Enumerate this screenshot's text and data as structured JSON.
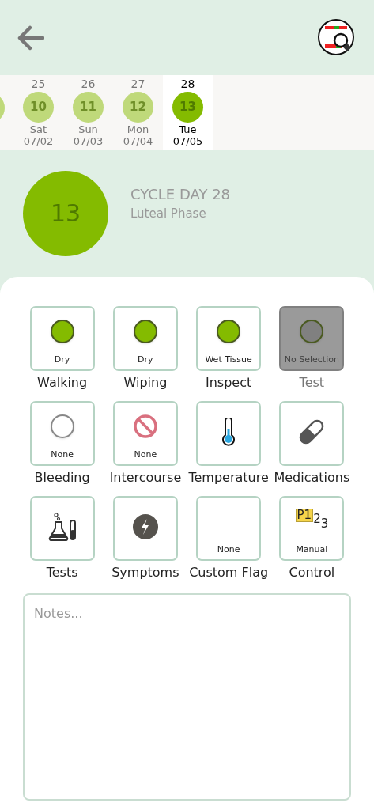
{
  "days": [
    {
      "number": "25",
      "cycle_day": "10",
      "dow": "Sat",
      "date": "07/02",
      "selected": false
    },
    {
      "number": "26",
      "cycle_day": "11",
      "dow": "Sun",
      "date": "07/03",
      "selected": false
    },
    {
      "number": "27",
      "cycle_day": "12",
      "dow": "Mon",
      "date": "07/04",
      "selected": false
    },
    {
      "number": "28",
      "cycle_day": "13",
      "dow": "Tue",
      "date": "07/05",
      "selected": true
    }
  ],
  "summary": {
    "cycle_day": "13",
    "title": "CYCLE DAY 28",
    "phase": "Luteal Phase"
  },
  "tiles": [
    {
      "kind": "dot",
      "color": "#84bb00",
      "value": "Dry",
      "label": "Walking",
      "dimmed": false
    },
    {
      "kind": "dot",
      "color": "#84bb00",
      "value": "Dry",
      "label": "Wiping",
      "dimmed": false
    },
    {
      "kind": "dot",
      "color": "#84bb00",
      "value": "Wet Tissue",
      "label": "Inspect",
      "dimmed": false
    },
    {
      "kind": "dot",
      "color": "#808080",
      "value": "No Selection",
      "label": "Test",
      "dimmed": true
    },
    {
      "kind": "dot",
      "color": "#ffffff",
      "value": "None",
      "label": "Bleeding",
      "dimmed": false
    },
    {
      "kind": "no",
      "value": "None",
      "label": "Intercourse",
      "dimmed": false
    },
    {
      "kind": "thermometer",
      "label": "Temperature",
      "dimmed": false
    },
    {
      "kind": "pill",
      "label": "Medications",
      "dimmed": false
    },
    {
      "kind": "flask",
      "label": "Tests",
      "dimmed": false
    },
    {
      "kind": "bolt",
      "label": "Symptoms",
      "dimmed": false
    },
    {
      "kind": "blank",
      "value": "None",
      "label": "Custom Flag",
      "dimmed": false
    },
    {
      "kind": "control",
      "glyphs": [
        "P1",
        "2",
        "3"
      ],
      "value": "Manual",
      "label": "Control",
      "dimmed": false
    }
  ],
  "notes": {
    "placeholder": "Notes..."
  }
}
